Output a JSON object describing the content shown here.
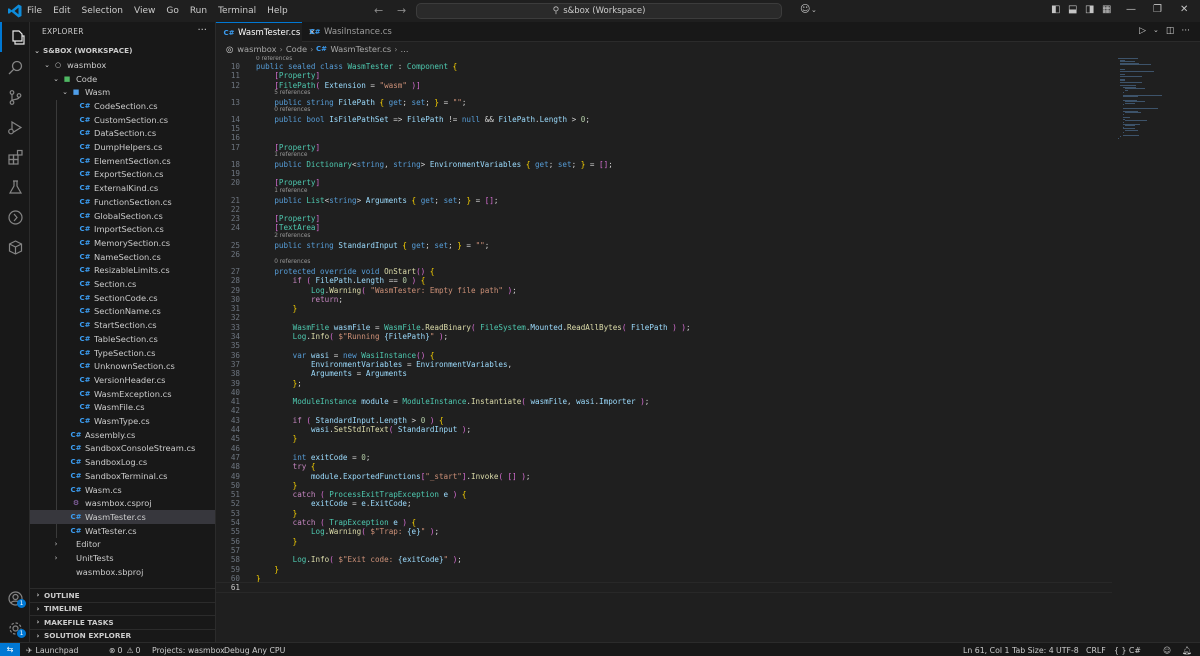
{
  "titlebar": {
    "menu": [
      "File",
      "Edit",
      "Selection",
      "View",
      "Go",
      "Run",
      "Terminal",
      "Help"
    ],
    "search_text": "s&box (Workspace)"
  },
  "sidebar": {
    "header": "EXPLORER",
    "workspace": "S&BOX (WORKSPACE)",
    "tree": [
      {
        "label": "wasmbox",
        "indent": 1,
        "icon": "circle",
        "chev": "down"
      },
      {
        "label": "Code",
        "indent": 2,
        "icon": "folder-green",
        "chev": "down"
      },
      {
        "label": "Wasm",
        "indent": 3,
        "icon": "folder-blue",
        "chev": "down"
      },
      {
        "label": "CodeSection.cs",
        "indent": 4,
        "icon": "cs"
      },
      {
        "label": "CustomSection.cs",
        "indent": 4,
        "icon": "cs"
      },
      {
        "label": "DataSection.cs",
        "indent": 4,
        "icon": "cs"
      },
      {
        "label": "DumpHelpers.cs",
        "indent": 4,
        "icon": "cs"
      },
      {
        "label": "ElementSection.cs",
        "indent": 4,
        "icon": "cs"
      },
      {
        "label": "ExportSection.cs",
        "indent": 4,
        "icon": "cs"
      },
      {
        "label": "ExternalKind.cs",
        "indent": 4,
        "icon": "cs"
      },
      {
        "label": "FunctionSection.cs",
        "indent": 4,
        "icon": "cs"
      },
      {
        "label": "GlobalSection.cs",
        "indent": 4,
        "icon": "cs"
      },
      {
        "label": "ImportSection.cs",
        "indent": 4,
        "icon": "cs"
      },
      {
        "label": "MemorySection.cs",
        "indent": 4,
        "icon": "cs"
      },
      {
        "label": "NameSection.cs",
        "indent": 4,
        "icon": "cs"
      },
      {
        "label": "ResizableLimits.cs",
        "indent": 4,
        "icon": "cs"
      },
      {
        "label": "Section.cs",
        "indent": 4,
        "icon": "cs"
      },
      {
        "label": "SectionCode.cs",
        "indent": 4,
        "icon": "cs"
      },
      {
        "label": "SectionName.cs",
        "indent": 4,
        "icon": "cs"
      },
      {
        "label": "StartSection.cs",
        "indent": 4,
        "icon": "cs"
      },
      {
        "label": "TableSection.cs",
        "indent": 4,
        "icon": "cs"
      },
      {
        "label": "TypeSection.cs",
        "indent": 4,
        "icon": "cs"
      },
      {
        "label": "UnknownSection.cs",
        "indent": 4,
        "icon": "cs"
      },
      {
        "label": "VersionHeader.cs",
        "indent": 4,
        "icon": "cs"
      },
      {
        "label": "WasmException.cs",
        "indent": 4,
        "icon": "cs"
      },
      {
        "label": "WasmFile.cs",
        "indent": 4,
        "icon": "cs"
      },
      {
        "label": "WasmType.cs",
        "indent": 4,
        "icon": "cs"
      },
      {
        "label": "Assembly.cs",
        "indent": 3,
        "icon": "cs"
      },
      {
        "label": "SandboxConsoleStream.cs",
        "indent": 3,
        "icon": "cs"
      },
      {
        "label": "SandboxLog.cs",
        "indent": 3,
        "icon": "cs"
      },
      {
        "label": "SandboxTerminal.cs",
        "indent": 3,
        "icon": "cs"
      },
      {
        "label": "Wasm.cs",
        "indent": 3,
        "icon": "cs"
      },
      {
        "label": "wasmbox.csproj",
        "indent": 3,
        "icon": "proj"
      },
      {
        "label": "WasmTester.cs",
        "indent": 3,
        "icon": "cs",
        "selected": true
      },
      {
        "label": "WatTester.cs",
        "indent": 3,
        "icon": "cs"
      },
      {
        "label": "Editor",
        "indent": 2,
        "icon": "folder",
        "chev": "right"
      },
      {
        "label": "UnitTests",
        "indent": 2,
        "icon": "folder",
        "chev": "right"
      },
      {
        "label": "wasmbox.sbproj",
        "indent": 2,
        "icon": "sbproj"
      }
    ],
    "sections": [
      "OUTLINE",
      "TIMELINE",
      "MAKEFILE TASKS",
      "SOLUTION EXPLORER"
    ]
  },
  "tabs": [
    {
      "label": "WasmTester.cs",
      "active": true
    },
    {
      "label": "WasiInstance.cs",
      "active": false
    }
  ],
  "breadcrumb": [
    "wasmbox",
    "Code",
    "WasmTester.cs",
    "..."
  ],
  "code": {
    "top_codelens": "0 references",
    "lines": [
      {
        "n": 10,
        "lens_before": "",
        "text": "public sealed class WasmTester : Component {"
      },
      {
        "n": 11,
        "text": "    [Property]"
      },
      {
        "n": 12,
        "text": "    [FilePath( Extension = \"wasm\" )]"
      },
      {
        "n": 13,
        "lens": "5 references",
        "text": "    public string FilePath { get; set; } = \"\";"
      },
      {
        "n": 14,
        "lens": "0 references",
        "text": "    public bool IsFilePathSet => FilePath != null && FilePath.Length > 0;"
      },
      {
        "n": 15,
        "text": ""
      },
      {
        "n": 16,
        "text": ""
      },
      {
        "n": 17,
        "text": "    [Property]"
      },
      {
        "n": 18,
        "lens": "1 reference",
        "text": "    public Dictionary<string, string> EnvironmentVariables { get; set; } = [];"
      },
      {
        "n": 19,
        "text": ""
      },
      {
        "n": 20,
        "text": "    [Property]"
      },
      {
        "n": 21,
        "lens": "1 reference",
        "text": "    public List<string> Arguments { get; set; } = [];"
      },
      {
        "n": 22,
        "text": ""
      },
      {
        "n": 23,
        "text": "    [Property]"
      },
      {
        "n": 24,
        "text": "    [TextArea]"
      },
      {
        "n": 25,
        "lens": "2 references",
        "text": "    public string StandardInput { get; set; } = \"\";"
      },
      {
        "n": 26,
        "text": ""
      },
      {
        "n": 27,
        "lens": "0 references",
        "text": "    protected override void OnStart() {"
      },
      {
        "n": 28,
        "text": "        if ( FilePath.Length == 0 ) {"
      },
      {
        "n": 29,
        "text": "            Log.Warning( \"WasmTester: Empty file path\" );"
      },
      {
        "n": 30,
        "text": "            return;"
      },
      {
        "n": 31,
        "text": "        }"
      },
      {
        "n": 32,
        "text": ""
      },
      {
        "n": 33,
        "text": "        WasmFile wasmFile = WasmFile.ReadBinary( FileSystem.Mounted.ReadAllBytes( FilePath ) );"
      },
      {
        "n": 34,
        "text": "        Log.Info( $\"Running {FilePath}\" );"
      },
      {
        "n": 35,
        "text": ""
      },
      {
        "n": 36,
        "text": "        var wasi = new WasiInstance() {"
      },
      {
        "n": 37,
        "text": "            EnvironmentVariables = EnvironmentVariables,"
      },
      {
        "n": 38,
        "text": "            Arguments = Arguments"
      },
      {
        "n": 39,
        "text": "        };"
      },
      {
        "n": 40,
        "text": ""
      },
      {
        "n": 41,
        "text": "        ModuleInstance module = ModuleInstance.Instantiate( wasmFile, wasi.Importer );"
      },
      {
        "n": 42,
        "text": ""
      },
      {
        "n": 43,
        "text": "        if ( StandardInput.Length > 0 ) {"
      },
      {
        "n": 44,
        "text": "            wasi.SetStdInText( StandardInput );"
      },
      {
        "n": 45,
        "text": "        }"
      },
      {
        "n": 46,
        "text": ""
      },
      {
        "n": 47,
        "text": "        int exitCode = 0;"
      },
      {
        "n": 48,
        "text": "        try {"
      },
      {
        "n": 49,
        "text": "            module.ExportedFunctions[\"_start\"].Invoke( [] );"
      },
      {
        "n": 50,
        "text": "        }"
      },
      {
        "n": 51,
        "text": "        catch ( ProcessExitTrapException e ) {"
      },
      {
        "n": 52,
        "text": "            exitCode = e.ExitCode;"
      },
      {
        "n": 53,
        "text": "        }"
      },
      {
        "n": 54,
        "text": "        catch ( TrapException e ) {"
      },
      {
        "n": 55,
        "text": "            Log.Warning( $\"Trap: {e}\" );"
      },
      {
        "n": 56,
        "text": "        }"
      },
      {
        "n": 57,
        "text": ""
      },
      {
        "n": 58,
        "text": "        Log.Info( $\"Exit code: {exitCode}\" );"
      },
      {
        "n": 59,
        "text": "    }"
      },
      {
        "n": 60,
        "text": "}"
      },
      {
        "n": 61,
        "text": ""
      }
    ]
  },
  "statusbar": {
    "launchpad": "Launchpad",
    "errors": "0",
    "warnings": "0",
    "projects": "Projects: wasmbox",
    "config": "Debug Any CPU",
    "position": "Ln 61, Col 1",
    "tab_size": "Tab Size: 4",
    "encoding": "UTF-8",
    "eol": "CRLF",
    "language": "{ } C#"
  },
  "activitybar": {
    "badges": [
      "1",
      "1"
    ]
  }
}
